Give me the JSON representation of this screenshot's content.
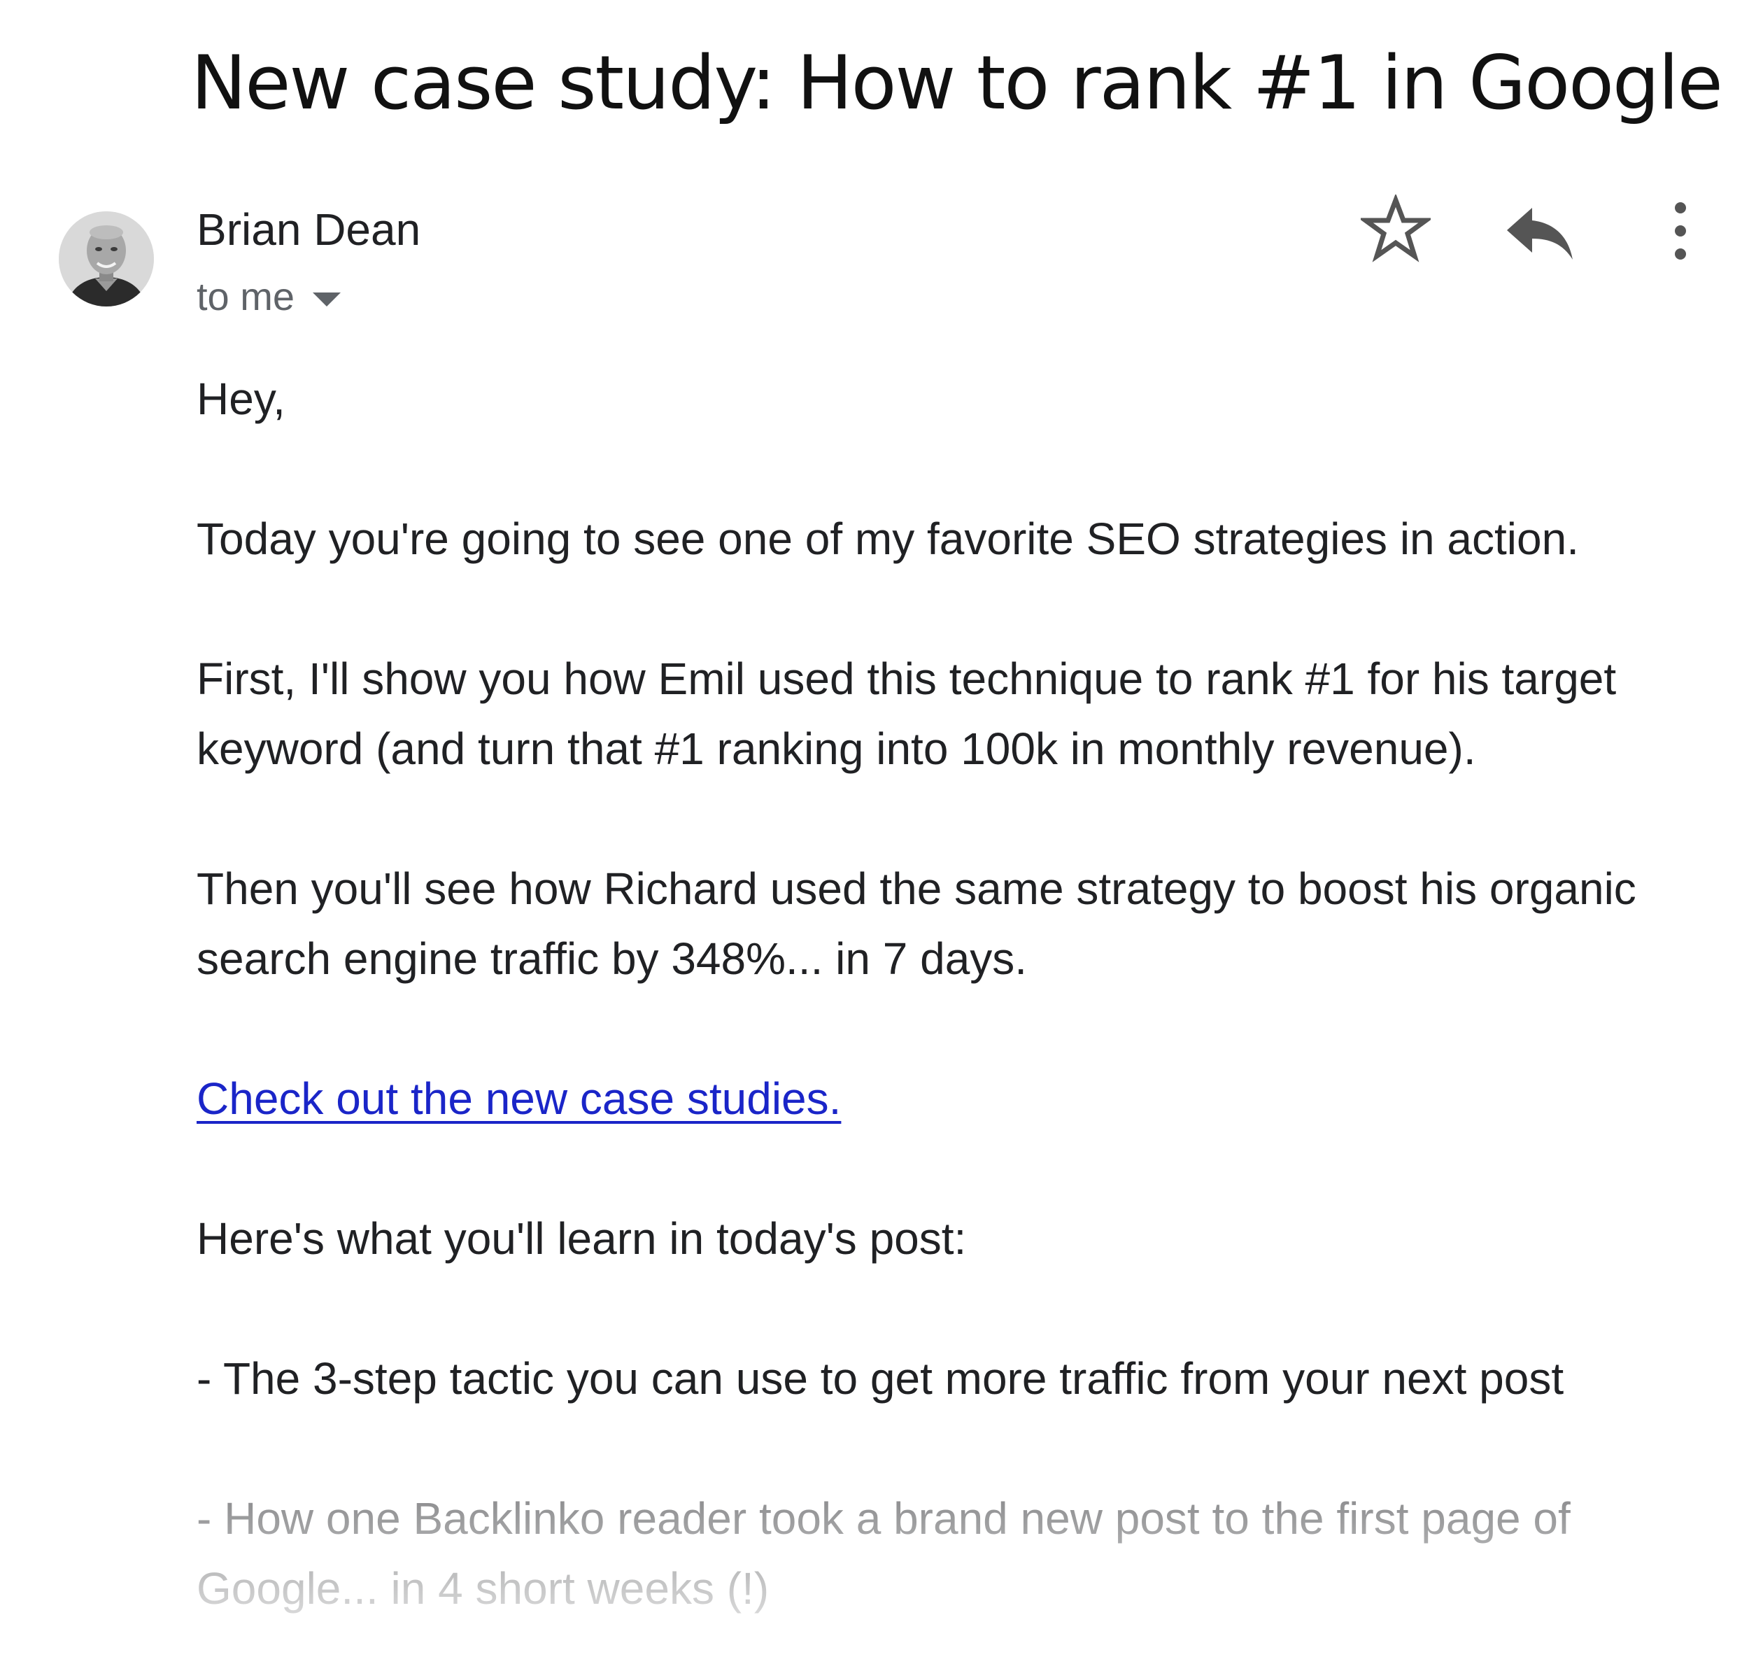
{
  "email": {
    "subject": "New case study: How to rank #1 in Google",
    "sender": {
      "name": "Brian Dean",
      "avatar_icon": "person-photo-icon"
    },
    "recipient_label": "to me",
    "actions": {
      "star_icon": "star-icon",
      "reply_icon": "reply-icon",
      "more_icon": "more-vertical-icon"
    },
    "body": {
      "greeting": "Hey,",
      "intro": "Today you're going to see one of my favorite SEO strategies in action.",
      "first_paragraph": "First, I'll show you how Emil used this technique to rank #1 for his target keyword (and turn that #1 ranking into 100k in monthly revenue).",
      "then_paragraph": "Then you'll see how Richard used the same strategy to boost his organic search engine traffic by 348%... in 7 days.",
      "link_text": "Check out the new case studies.",
      "learn_intro": "Here's what you'll learn in today's post:",
      "bullets": [
        "- The 3-step tactic you can use to get more traffic from your next post",
        "- How one Backlinko reader took a brand new post to the first page of Google... in 4 short weeks (!)"
      ]
    }
  },
  "colors": {
    "link": "#1a25c8",
    "text": "#202124",
    "muted": "#5f6368",
    "icon": "#555555"
  }
}
